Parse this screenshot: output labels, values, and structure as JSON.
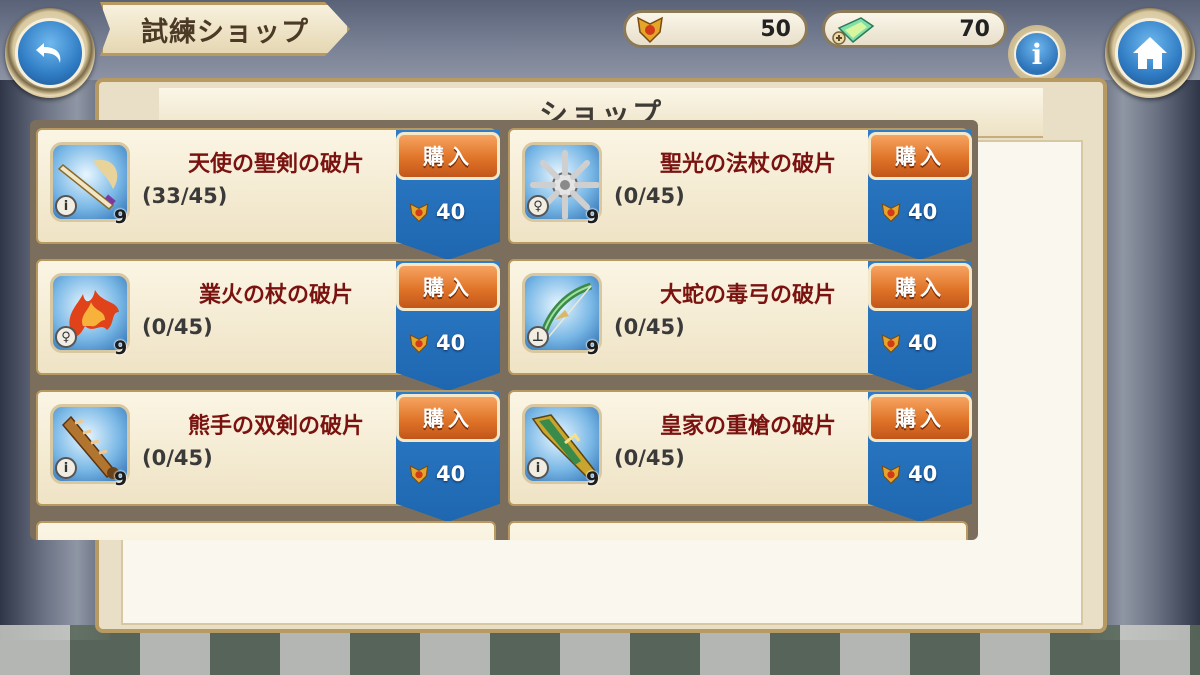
{
  "header": {
    "title": "試練ショップ",
    "currency_medal": "50",
    "currency_gem": "70"
  },
  "panel": {
    "title": "ショップ"
  },
  "items": [
    {
      "name": "天使の聖剣の破片",
      "progress": "(33/45)",
      "class_badge": "i",
      "rank": "9",
      "buy_label": "購入",
      "price": "40",
      "icon": "sword-shard-icon",
      "accent": "#d9b866"
    },
    {
      "name": "聖光の法杖の破片",
      "progress": "(0/45)",
      "class_badge": "♀",
      "rank": "9",
      "buy_label": "購入",
      "price": "40",
      "icon": "staff-shard-icon",
      "accent": "#c9c9c9"
    },
    {
      "name": "業火の杖の破片",
      "progress": "(0/45)",
      "class_badge": "♀",
      "rank": "9",
      "buy_label": "購入",
      "price": "40",
      "icon": "fire-staff-shard-icon",
      "accent": "#e0421a"
    },
    {
      "name": "大蛇の毒弓の破片",
      "progress": "(0/45)",
      "class_badge": "⊥",
      "rank": "9",
      "buy_label": "購入",
      "price": "40",
      "icon": "bow-shard-icon",
      "accent": "#4aa05a"
    },
    {
      "name": "熊手の双剣の破片",
      "progress": "(0/45)",
      "class_badge": "i",
      "rank": "9",
      "buy_label": "購入",
      "price": "40",
      "icon": "dual-blade-shard-icon",
      "accent": "#b27530"
    },
    {
      "name": "皇家の重槍の破片",
      "progress": "(0/45)",
      "class_badge": "i",
      "rank": "9",
      "buy_label": "購入",
      "price": "40",
      "icon": "lance-shard-icon",
      "accent": "#c9a530"
    }
  ],
  "colors": {
    "buy_orange": "#e07428",
    "ribbon_blue": "#1e66b0",
    "name_red": "#7a1210"
  }
}
